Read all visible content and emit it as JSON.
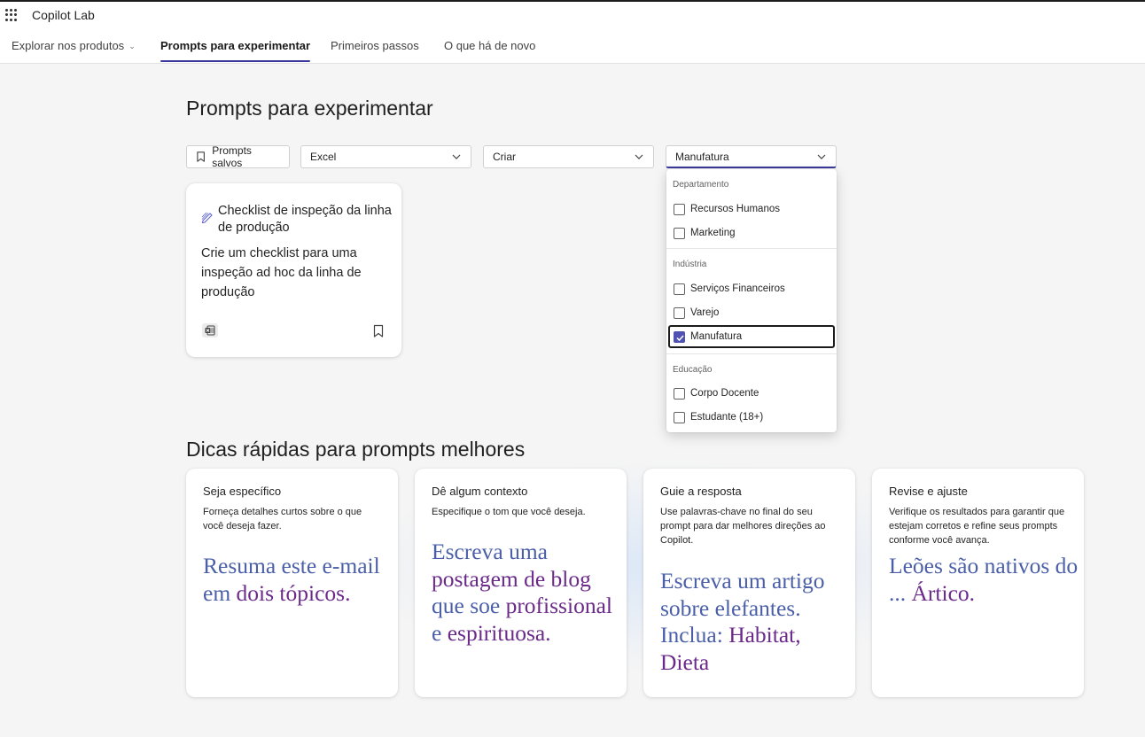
{
  "app": {
    "title": "Copilot Lab"
  },
  "nav": {
    "items": [
      {
        "label": "Explorar nos produtos"
      },
      {
        "label": "Prompts para experimentar"
      },
      {
        "label": "Primeiros passos"
      },
      {
        "label": "O que há de novo"
      }
    ]
  },
  "main": {
    "heading": "Prompts para experimentar",
    "tips_heading": "Dicas rápidas para prompts melhores"
  },
  "filters": {
    "saved_label": "Prompts salvos",
    "app_value": "Excel",
    "task_value": "Criar",
    "category_value": "Manufatura"
  },
  "prompt_card": {
    "title": "Checklist de inspeção da linha de produção",
    "description": "Crie um checklist para uma inspeção ad hoc da linha de produção",
    "app_icon": "excel-icon"
  },
  "dropdown": {
    "groups": [
      {
        "header": "Departamento",
        "options": [
          {
            "label": "Recursos Humanos",
            "checked": false
          },
          {
            "label": "Marketing",
            "checked": false
          }
        ]
      },
      {
        "header": "Indústria",
        "options": [
          {
            "label": "Serviços Financeiros",
            "checked": false
          },
          {
            "label": "Varejo",
            "checked": false
          },
          {
            "label": "Manufatura",
            "checked": true
          }
        ]
      },
      {
        "header": "Educação",
        "options": [
          {
            "label": "Corpo Docente",
            "checked": false
          },
          {
            "label": "Estudante (18+)",
            "checked": false
          }
        ]
      }
    ]
  },
  "tips": [
    {
      "title": "Seja específico",
      "description": "Forneça detalhes curtos sobre o que você deseja fazer.",
      "example_parts": [
        "Resuma este e-mail em ",
        "dois tópicos."
      ]
    },
    {
      "title": "Dê algum contexto",
      "description": "Especifique o tom que você deseja.",
      "example_parts": [
        "Escreva uma ",
        "postagem de blog",
        " que soe ",
        "profissional",
        " e ",
        "espirituosa."
      ]
    },
    {
      "title": "Guie a resposta",
      "description": "Use palavras-chave no final do seu prompt para dar melhores direções ao Copilot.",
      "example_parts": [
        "Escreva um artigo sobre elefantes. Inclua: ",
        "Habitat, Dieta"
      ]
    },
    {
      "title": "Revise e ajuste",
      "description": "Verifique os resultados para garantir que estejam corretos e refine seus prompts conforme você avança.",
      "example_parts": [
        "Leões são nativos do ... ",
        "Ártico."
      ]
    }
  ],
  "colors": {
    "accent": "#4f52b2",
    "nav_underline": "#3c3a9c",
    "example_blue": "#4a5fa8",
    "example_purple": "#6b2a8a"
  }
}
